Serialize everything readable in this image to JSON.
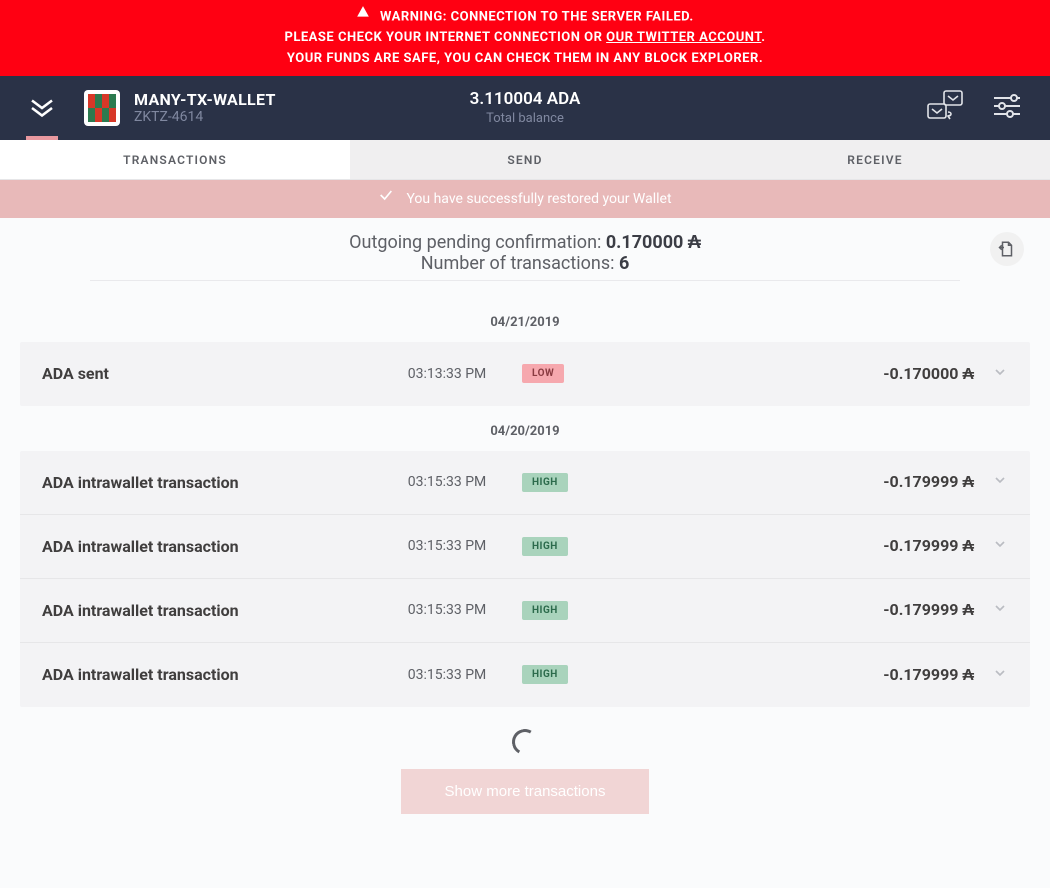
{
  "warning": {
    "line1": "WARNING: CONNECTION TO THE SERVER FAILED.",
    "line2_prefix": "PLEASE CHECK YOUR INTERNET CONNECTION OR ",
    "line2_link": "OUR TWITTER ACCOUNT",
    "line2_suffix": ".",
    "line3": "YOUR FUNDS ARE SAFE, YOU CAN CHECK THEM IN ANY BLOCK EXPLORER."
  },
  "header": {
    "wallet_name": "MANY-TX-WALLET",
    "wallet_hash": "ZKTZ-4614",
    "balance_amount": "3.110004 ADA",
    "balance_label": "Total balance"
  },
  "tabs": {
    "transactions": "TRANSACTIONS",
    "send": "SEND",
    "receive": "RECEIVE",
    "active": "transactions"
  },
  "notification": {
    "text": "You have successfully restored your Wallet"
  },
  "summary": {
    "pending_label": "Outgoing pending confirmation: ",
    "pending_value": "0.170000",
    "pending_currency": "₳",
    "count_label": "Number of transactions: ",
    "count_value": "6"
  },
  "currency_symbol": "₳",
  "groups": [
    {
      "date": "04/21/2019",
      "items": [
        {
          "title": "ADA sent",
          "time": "03:13:33 PM",
          "badge": "LOW",
          "amount": "-0.170000"
        }
      ]
    },
    {
      "date": "04/20/2019",
      "items": [
        {
          "title": "ADA intrawallet transaction",
          "time": "03:15:33 PM",
          "badge": "HIGH",
          "amount": "-0.179999"
        },
        {
          "title": "ADA intrawallet transaction",
          "time": "03:15:33 PM",
          "badge": "HIGH",
          "amount": "-0.179999"
        },
        {
          "title": "ADA intrawallet transaction",
          "time": "03:15:33 PM",
          "badge": "HIGH",
          "amount": "-0.179999"
        },
        {
          "title": "ADA intrawallet transaction",
          "time": "03:15:33 PM",
          "badge": "HIGH",
          "amount": "-0.179999"
        }
      ]
    }
  ],
  "show_more_label": "Show more transactions"
}
